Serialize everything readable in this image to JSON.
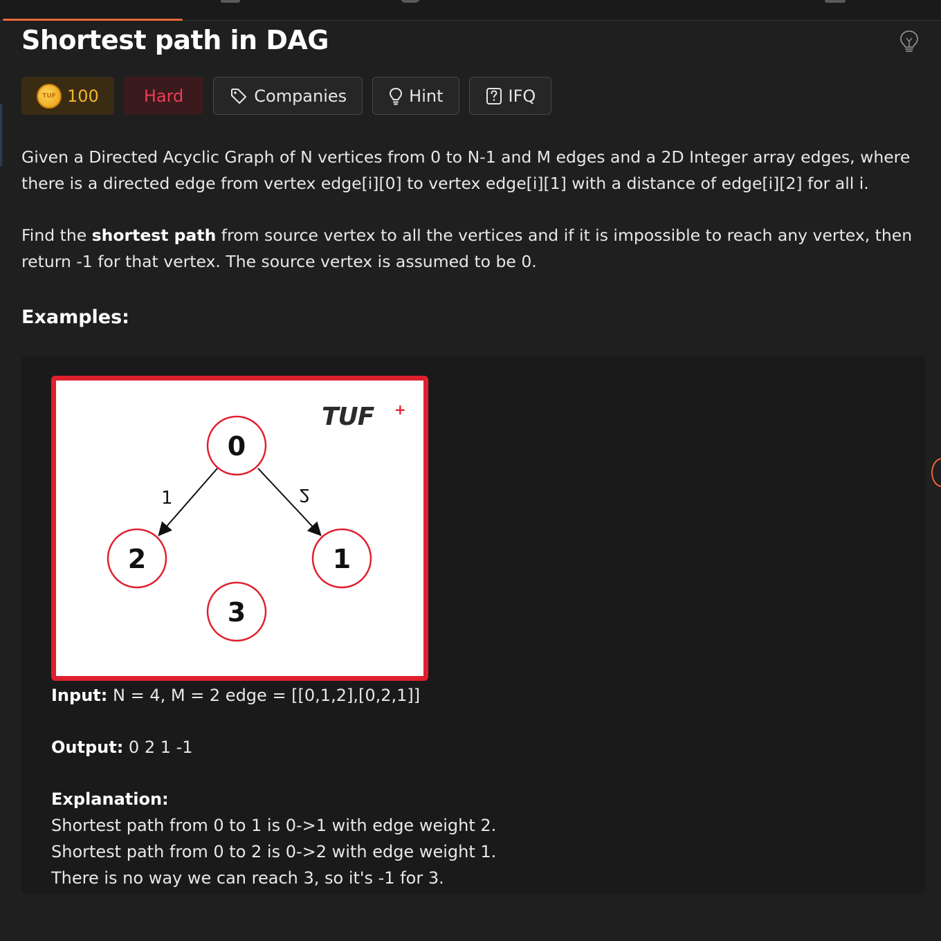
{
  "problem": {
    "title": "Shortest path in DAG",
    "tags": {
      "coins": "100",
      "coin_logo_text": "TUF",
      "difficulty": "Hard",
      "companies": "Companies",
      "hint": "Hint",
      "ifq": "IFQ"
    },
    "description": {
      "p1": "Given a Directed Acyclic Graph of N vertices from 0 to N-1 and M edges and a 2D Integer array edges, where there is a directed edge from vertex edge[i][0] to vertex edge[i][1] with a distance of edge[i][2] for all i.",
      "p2_pre": "Find the ",
      "p2_bold": "shortest path",
      "p2_post": " from source vertex to all the vertices and if it is impossible to reach any vertex, then return -1 for that vertex. The source vertex is assumed to be 0."
    },
    "examples_heading": "Examples:",
    "example": {
      "diagram": {
        "brand": "TUF",
        "brand_plus": "+",
        "nodes": [
          "0",
          "2",
          "1",
          "3"
        ],
        "edge_labels": [
          "1",
          "2"
        ]
      },
      "input_label": "Input:",
      "input_value": " N = 4, M = 2 edge = [[0,1,2],[0,2,1]]",
      "output_label": "Output:",
      "output_value": " 0 2 1 -1",
      "explanation_label": "Explanation:",
      "explanation_lines": [
        "Shortest path from 0 to 1 is 0->1 with edge weight 2.",
        "Shortest path from 0 to 2 is 0->2 with edge weight 1.",
        "There is no way we can reach 3, so it's -1 for 3."
      ]
    }
  },
  "colors": {
    "accent": "#e8683a",
    "difficulty_hard": "#ee3d55",
    "coin": "#f5b628",
    "diagram_red": "#e0202e"
  },
  "icons": [
    "lightbulb-icon",
    "tag-icon",
    "hint-bulb-icon",
    "question-doc-icon",
    "coin-icon"
  ]
}
